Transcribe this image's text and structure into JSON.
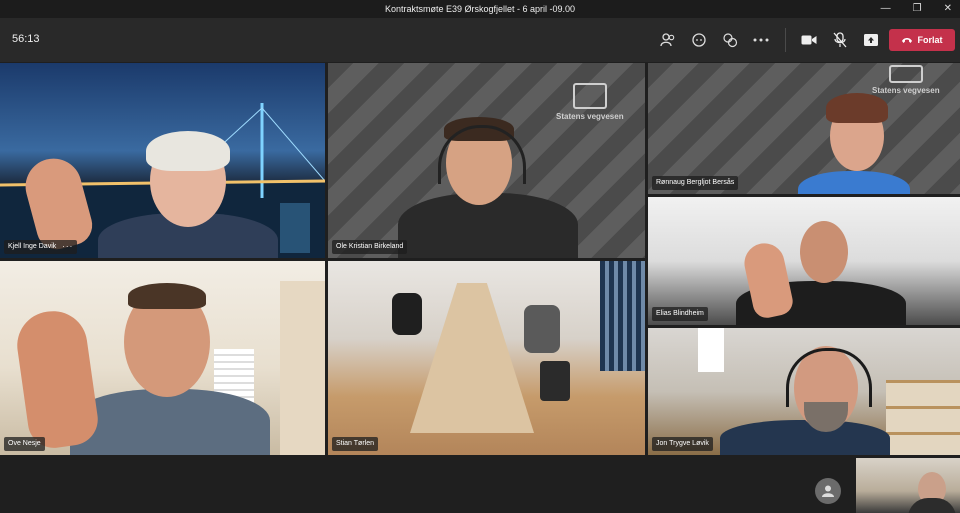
{
  "window": {
    "title": "Kontraktsmøte E39 Ørskogfjellet - 6 april -09.00",
    "controls": [
      "—",
      "❐",
      "✕"
    ]
  },
  "toolbar": {
    "timer": "56:13",
    "icons": [
      "participants-icon",
      "chat-icon",
      "reactions-icon",
      "more-icon",
      "camera-icon",
      "mic-off-icon",
      "share-icon"
    ],
    "leave_label": "Forlat",
    "leave_color": "#c4314b"
  },
  "brand": {
    "name": "Statens vegvesen"
  },
  "participants": [
    {
      "name": "Kjell Inge Davik",
      "more": "···"
    },
    {
      "name": "Ole Kristian Birkeland"
    },
    {
      "name": "Rønnaug Bergljot Bersås"
    },
    {
      "name": "Elias Blindheim"
    },
    {
      "name": "Ove Nesje"
    },
    {
      "name": "Stian Tørlen"
    },
    {
      "name": "Jon Trygve Løvik"
    }
  ]
}
